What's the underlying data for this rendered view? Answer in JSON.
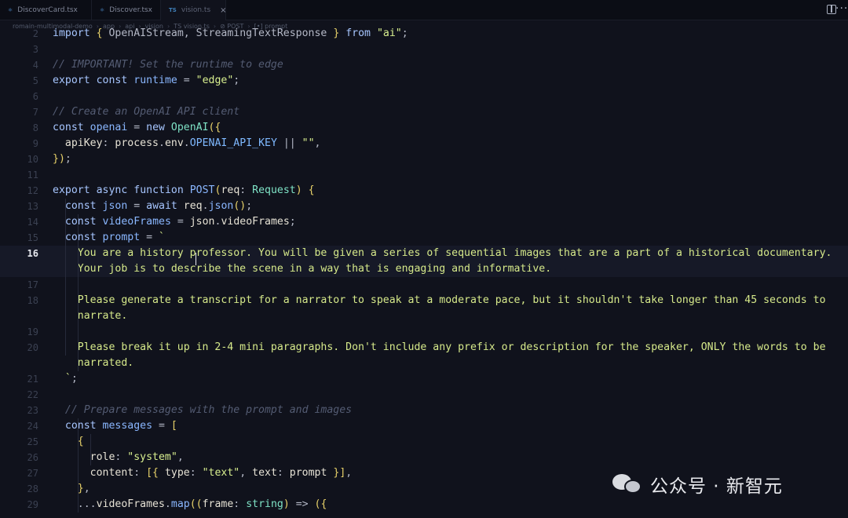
{
  "tabs": [
    {
      "label": "DiscoverCard.tsx",
      "icon": "react-file-icon",
      "active": false
    },
    {
      "label": "Discover.tsx",
      "icon": "react-file-icon",
      "active": false
    },
    {
      "label": "vision.ts",
      "icon": "typescript-file-icon",
      "icon_text": "TS",
      "active": true
    }
  ],
  "tab_close_glyph": "×",
  "file_icon_glyph": "⚛",
  "breadcrumb": [
    "romain-multimodal-demo",
    "app",
    "api",
    "vision",
    "TS vision.ts",
    "⊘ POST",
    "[•] prompt"
  ],
  "breadcrumb_separator": "›",
  "toolbar": {
    "split_editor_icon": "split-editor-icon",
    "more_icon": "more-actions-icon",
    "more_glyph": "···"
  },
  "editor": {
    "active_line": 16,
    "lines": [
      {
        "n": "2",
        "tokens": [
          [
            "kw",
            "import"
          ],
          [
            "pn",
            " "
          ],
          [
            "br",
            "{"
          ],
          [
            "pn",
            " OpenAIStream, StreamingTextResponse "
          ],
          [
            "br",
            "}"
          ],
          [
            "pn",
            " "
          ],
          [
            "kw",
            "from"
          ],
          [
            "pn",
            " "
          ],
          [
            "str",
            "\"ai\""
          ],
          [
            "pn",
            ";"
          ]
        ]
      },
      {
        "n": "3",
        "tokens": []
      },
      {
        "n": "4",
        "tokens": [
          [
            "cm",
            "// IMPORTANT! Set the runtime to edge"
          ]
        ]
      },
      {
        "n": "5",
        "tokens": [
          [
            "kw",
            "export"
          ],
          [
            "pn",
            " "
          ],
          [
            "kw",
            "const"
          ],
          [
            "pn",
            " "
          ],
          [
            "fn",
            "runtime"
          ],
          [
            "pn",
            " = "
          ],
          [
            "str",
            "\"edge\""
          ],
          [
            "pn",
            ";"
          ]
        ]
      },
      {
        "n": "6",
        "tokens": []
      },
      {
        "n": "7",
        "tokens": [
          [
            "cm",
            "// Create an OpenAI API client"
          ]
        ]
      },
      {
        "n": "8",
        "tokens": [
          [
            "kw",
            "const"
          ],
          [
            "pn",
            " "
          ],
          [
            "fn",
            "openai"
          ],
          [
            "pn",
            " = "
          ],
          [
            "kw",
            "new"
          ],
          [
            "pn",
            " "
          ],
          [
            "ty",
            "OpenAI"
          ],
          [
            "br",
            "({"
          ]
        ]
      },
      {
        "n": "9",
        "tokens": [
          [
            "pn",
            "  "
          ],
          [
            "pr",
            "apiKey"
          ],
          [
            "pn",
            ": "
          ],
          [
            "pr",
            "process"
          ],
          [
            "pn",
            "."
          ],
          [
            "pr",
            "env"
          ],
          [
            "pn",
            "."
          ],
          [
            "cn",
            "OPENAI_API_KEY"
          ],
          [
            "pn",
            " || "
          ],
          [
            "str",
            "\"\""
          ],
          [
            "pn",
            ","
          ]
        ]
      },
      {
        "n": "10",
        "tokens": [
          [
            "br",
            "})"
          ],
          [
            "pn",
            ";"
          ]
        ]
      },
      {
        "n": "11",
        "tokens": []
      },
      {
        "n": "12",
        "tokens": [
          [
            "kw",
            "export"
          ],
          [
            "pn",
            " "
          ],
          [
            "kw",
            "async"
          ],
          [
            "pn",
            " "
          ],
          [
            "kw",
            "function"
          ],
          [
            "pn",
            " "
          ],
          [
            "fn",
            "POST"
          ],
          [
            "br",
            "("
          ],
          [
            "pr",
            "req"
          ],
          [
            "pn",
            ": "
          ],
          [
            "ty",
            "Request"
          ],
          [
            "br",
            ")"
          ],
          [
            "pn",
            " "
          ],
          [
            "br",
            "{"
          ]
        ]
      },
      {
        "n": "13",
        "tokens": [
          [
            "pn",
            "  "
          ],
          [
            "kw",
            "const"
          ],
          [
            "pn",
            " "
          ],
          [
            "fn",
            "json"
          ],
          [
            "pn",
            " = "
          ],
          [
            "kw",
            "await"
          ],
          [
            "pn",
            " "
          ],
          [
            "pr",
            "req"
          ],
          [
            "pn",
            "."
          ],
          [
            "fn",
            "json"
          ],
          [
            "br",
            "()"
          ],
          [
            "pn",
            ";"
          ]
        ]
      },
      {
        "n": "14",
        "tokens": [
          [
            "pn",
            "  "
          ],
          [
            "kw",
            "const"
          ],
          [
            "pn",
            " "
          ],
          [
            "fn",
            "videoFrames"
          ],
          [
            "pn",
            " = "
          ],
          [
            "pr",
            "json"
          ],
          [
            "pn",
            "."
          ],
          [
            "pr",
            "videoFrames"
          ],
          [
            "pn",
            ";"
          ]
        ]
      },
      {
        "n": "15",
        "tokens": [
          [
            "pn",
            "  "
          ],
          [
            "kw",
            "const"
          ],
          [
            "pn",
            " "
          ],
          [
            "fn",
            "prompt"
          ],
          [
            "pn",
            " = "
          ],
          [
            "tpl",
            "`"
          ]
        ]
      },
      {
        "n": "16",
        "tokens": [
          [
            "tpl",
            "    You are a history professor. You will be given a series of sequential images that are a part of a historical documentary."
          ]
        ]
      },
      {
        "n": "",
        "tokens": [
          [
            "tpl",
            "    Your job is to describe the scene in a way that is engaging and informative."
          ]
        ]
      },
      {
        "n": "17",
        "tokens": []
      },
      {
        "n": "18",
        "tokens": [
          [
            "tpl",
            "    Please generate a transcript for a narrator to speak at a moderate pace, but it shouldn't take longer than 45 seconds to"
          ]
        ]
      },
      {
        "n": "",
        "tokens": [
          [
            "tpl",
            "    narrate."
          ]
        ]
      },
      {
        "n": "19",
        "tokens": []
      },
      {
        "n": "20",
        "tokens": [
          [
            "tpl",
            "    Please break it up in 2-4 mini paragraphs. Don't include any prefix or description for the speaker, ONLY the words to be"
          ]
        ]
      },
      {
        "n": "",
        "tokens": [
          [
            "tpl",
            "    narrated."
          ]
        ]
      },
      {
        "n": "21",
        "tokens": [
          [
            "tpl",
            "  `"
          ],
          [
            "pn",
            ";"
          ]
        ]
      },
      {
        "n": "22",
        "tokens": []
      },
      {
        "n": "23",
        "tokens": [
          [
            "pn",
            "  "
          ],
          [
            "cm",
            "// Prepare messages with the prompt and images"
          ]
        ]
      },
      {
        "n": "24",
        "tokens": [
          [
            "pn",
            "  "
          ],
          [
            "kw",
            "const"
          ],
          [
            "pn",
            " "
          ],
          [
            "fn",
            "messages"
          ],
          [
            "pn",
            " = "
          ],
          [
            "br",
            "["
          ]
        ]
      },
      {
        "n": "25",
        "tokens": [
          [
            "pn",
            "    "
          ],
          [
            "br",
            "{"
          ]
        ]
      },
      {
        "n": "26",
        "tokens": [
          [
            "pn",
            "      "
          ],
          [
            "pr",
            "role"
          ],
          [
            "pn",
            ": "
          ],
          [
            "str",
            "\"system\""
          ],
          [
            "pn",
            ","
          ]
        ]
      },
      {
        "n": "27",
        "tokens": [
          [
            "pn",
            "      "
          ],
          [
            "pr",
            "content"
          ],
          [
            "pn",
            ": "
          ],
          [
            "br",
            "[{"
          ],
          [
            "pn",
            " "
          ],
          [
            "pr",
            "type"
          ],
          [
            "pn",
            ": "
          ],
          [
            "str",
            "\"text\""
          ],
          [
            "pn",
            ", "
          ],
          [
            "pr",
            "text"
          ],
          [
            "pn",
            ": "
          ],
          [
            "pr",
            "prompt"
          ],
          [
            "pn",
            " "
          ],
          [
            "br",
            "}]"
          ],
          [
            "pn",
            ","
          ]
        ]
      },
      {
        "n": "28",
        "tokens": [
          [
            "pn",
            "    "
          ],
          [
            "br",
            "}"
          ],
          [
            "pn",
            ","
          ]
        ]
      },
      {
        "n": "29",
        "tokens": [
          [
            "pn",
            "    ..."
          ],
          [
            "pr",
            "videoFrames"
          ],
          [
            "pn",
            "."
          ],
          [
            "fn",
            "map"
          ],
          [
            "br",
            "(("
          ],
          [
            "pr",
            "frame"
          ],
          [
            "pn",
            ": "
          ],
          [
            "ty",
            "string"
          ],
          [
            "br",
            ")"
          ],
          [
            "pn",
            " => "
          ],
          [
            "br",
            "({"
          ]
        ]
      }
    ]
  },
  "watermark": {
    "text": "公众号 · 新智元",
    "icon": "wechat-icon"
  }
}
